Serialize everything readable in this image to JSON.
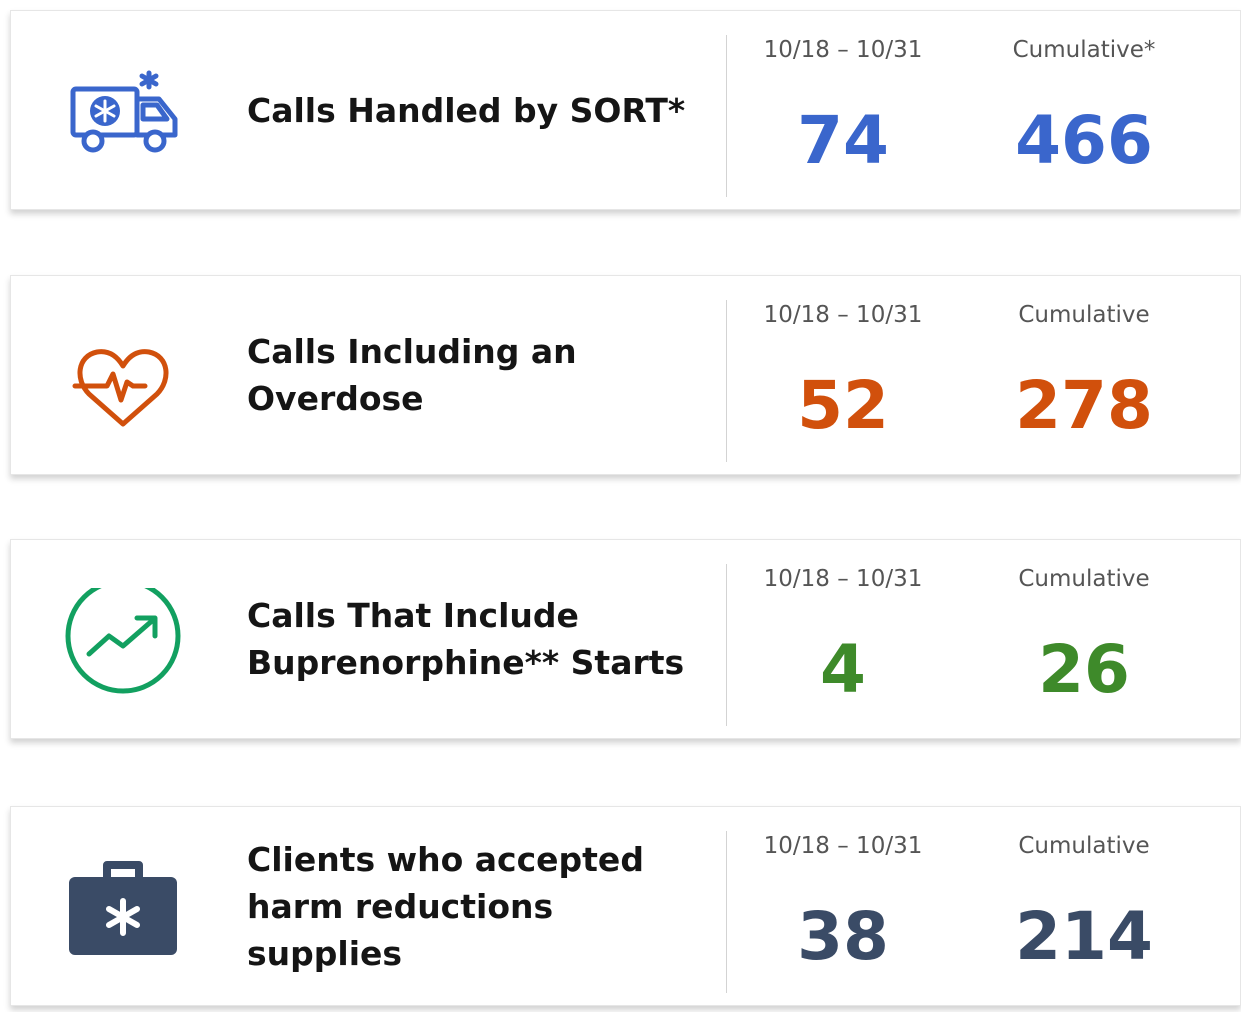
{
  "cards": [
    {
      "icon": "ambulance-icon",
      "label_lines": [
        "Calls Handled by SORT*"
      ],
      "period_label": "10/18 – 10/31",
      "period_value": "74",
      "cumulative_label": "Cumulative*",
      "cumulative_value": "466",
      "color": "#3a66cc"
    },
    {
      "icon": "heart-pulse-icon",
      "label_lines": [
        "Calls Including an",
        "Overdose"
      ],
      "period_label": "10/18 – 10/31",
      "period_value": "52",
      "cumulative_label": "Cumulative",
      "cumulative_value": "278",
      "color": "#d1500c"
    },
    {
      "icon": "trend-up-icon",
      "label_lines": [
        "Calls That Include",
        "Buprenorphine** Starts"
      ],
      "period_label": "10/18 – 10/31",
      "period_value": "4",
      "cumulative_label": "Cumulative",
      "cumulative_value": "26",
      "color": "#3e8a2a",
      "icon_color": "#12a060"
    },
    {
      "icon": "medical-kit-icon",
      "label_lines": [
        "Clients who accepted",
        "harm reductions supplies"
      ],
      "period_label": "10/18 – 10/31",
      "period_value": "38",
      "cumulative_label": "Cumulative",
      "cumulative_value": "214",
      "color": "#3a4b66"
    }
  ]
}
